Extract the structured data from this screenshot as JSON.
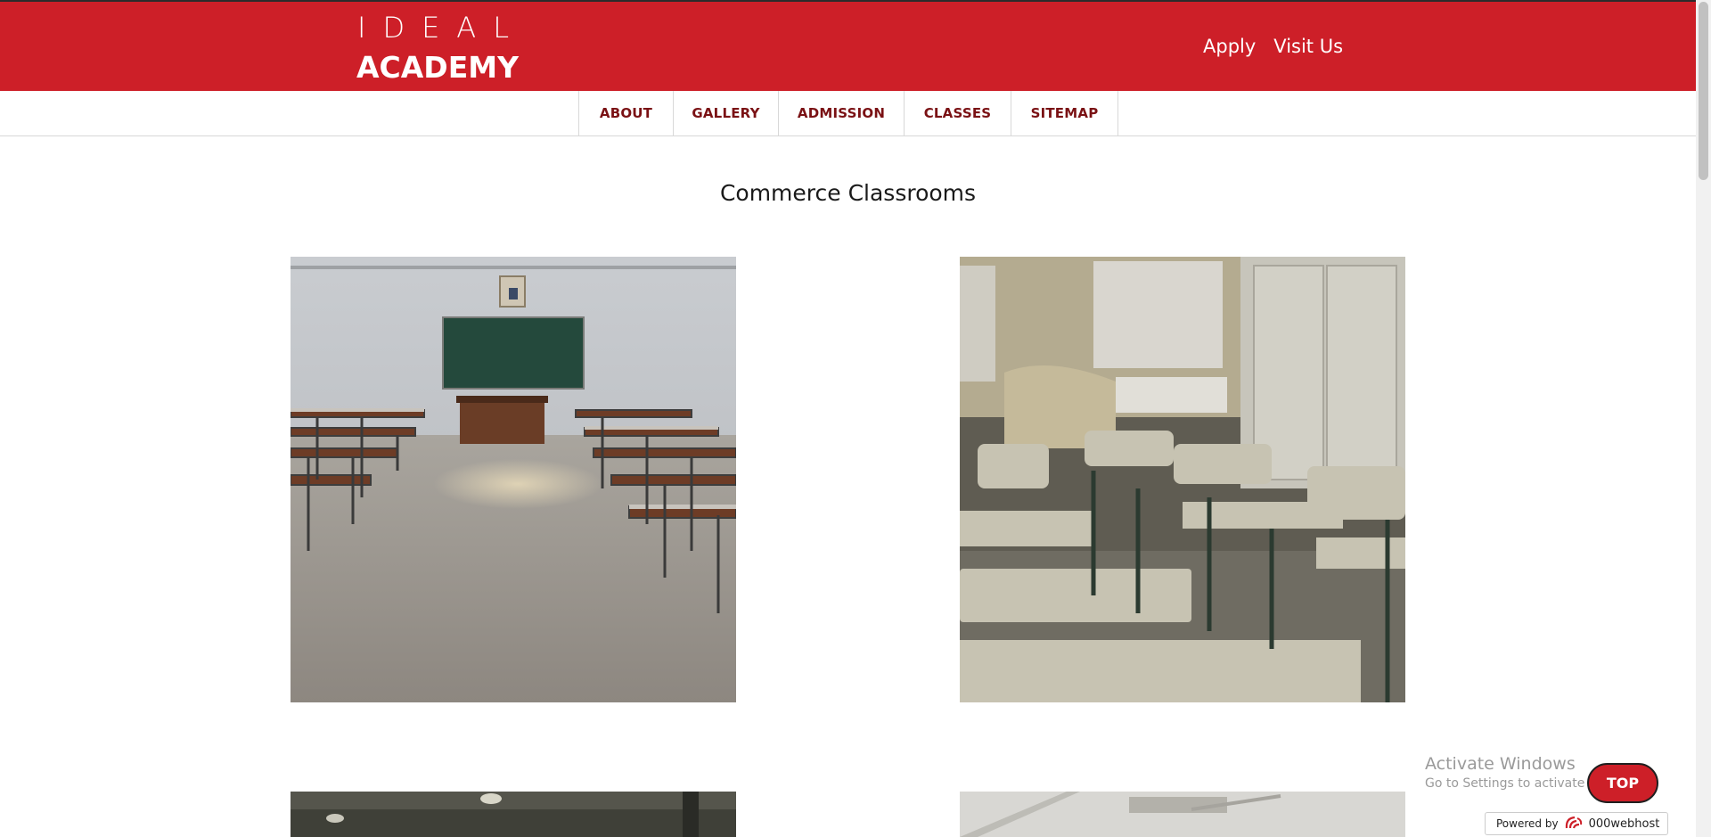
{
  "brand": {
    "line1": "IDEAL",
    "line2": "ACADEMY"
  },
  "top_links": [
    {
      "label": "Apply",
      "name": "apply-link"
    },
    {
      "label": "Visit Us",
      "name": "visit-us-link"
    }
  ],
  "nav": [
    {
      "label": "ABOUT",
      "name": "nav-about"
    },
    {
      "label": "GALLERY",
      "name": "nav-gallery"
    },
    {
      "label": "ADMISSION",
      "name": "nav-admission"
    },
    {
      "label": "CLASSES",
      "name": "nav-classes"
    },
    {
      "label": "SITEMAP",
      "name": "nav-sitemap"
    }
  ],
  "page_title": "Commerce Classrooms",
  "overlay": {
    "activate_title": "Activate Windows",
    "activate_sub": "Go to Settings to activate Windows.",
    "top_button": "TOP",
    "powered_by": "Powered by",
    "host_name": "000webhost"
  },
  "colors": {
    "brand_red": "#cd1f28",
    "nav_text": "#7a1114"
  }
}
